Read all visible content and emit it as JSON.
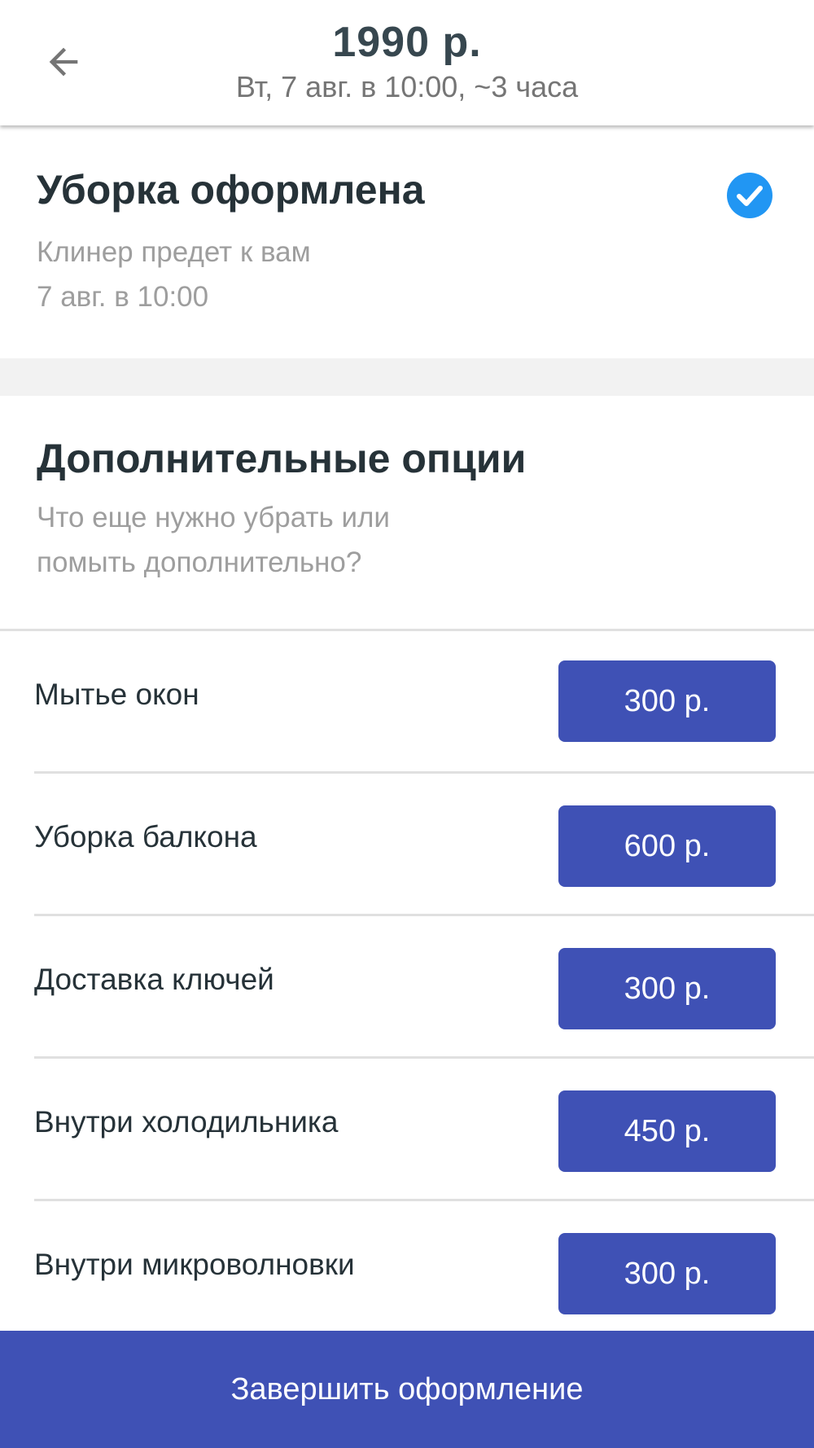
{
  "header": {
    "title": "1990 р.",
    "subtitle": "Вт, 7 авг. в 10:00, ~3 часа",
    "back_icon": "arrow-left-icon"
  },
  "confirmation": {
    "title": "Уборка оформлена",
    "line1": "Клинер предет к вам",
    "line2": "7 авг. в 10:00",
    "status_icon": "check-circle-icon",
    "accent_color": "#2196f3"
  },
  "options": {
    "title": "Дополнительные опции",
    "subtitle_line1": "Что еще нужно убрать или",
    "subtitle_line2": "помыть дополнительно?",
    "items": [
      {
        "label": "Мытье окон",
        "price": "300 р."
      },
      {
        "label": "Уборка балкона",
        "price": "600 р."
      },
      {
        "label": "Доставка ключей",
        "price": "300 р."
      },
      {
        "label": "Внутри холодильника",
        "price": "450 р."
      },
      {
        "label": "Внутри микроволновки",
        "price": "300 р."
      }
    ]
  },
  "footer": {
    "finish_label": "Завершить оформление"
  },
  "colors": {
    "primary": "#3f51b5",
    "text_dark": "#263238",
    "text_muted": "#9e9e9e"
  }
}
